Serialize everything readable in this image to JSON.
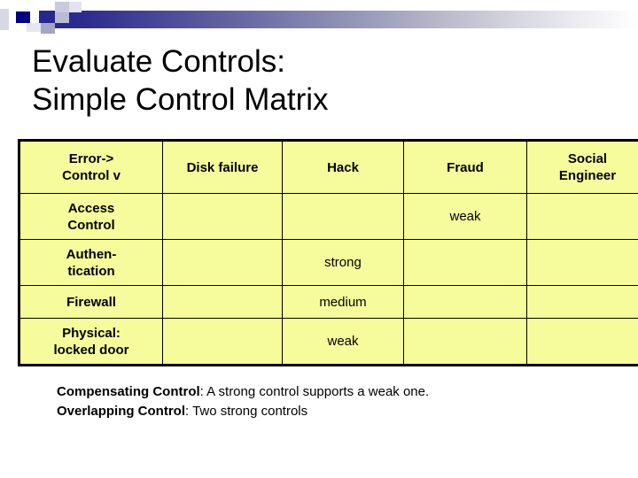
{
  "banner": {
    "gradient_start": "#26268c",
    "gradient_end": "#ffffff",
    "accent_square": "#000080"
  },
  "title": {
    "line1": "Evaluate Controls:",
    "line2": "Simple Control Matrix"
  },
  "matrix": {
    "cell_background": "#f6fb9c",
    "border_color": "#000000",
    "corner_header": {
      "line1": "Error->",
      "line2": "Control v"
    },
    "columns": [
      {
        "label": "Disk failure"
      },
      {
        "label": "Hack"
      },
      {
        "label": "Fraud"
      },
      {
        "label_line1": "Social",
        "label_line2": "Engineer"
      }
    ],
    "rows": [
      {
        "header_line1": "Access",
        "header_line2": "Control",
        "cells": [
          "",
          "",
          "weak",
          ""
        ]
      },
      {
        "header_line1": "Authen-",
        "header_line2": "tication",
        "cells": [
          "",
          "strong",
          "",
          ""
        ]
      },
      {
        "header_line1": "Firewall",
        "header_line2": "",
        "cells": [
          "",
          "medium",
          "",
          ""
        ]
      },
      {
        "header_line1": "Physical:",
        "header_line2": "locked door",
        "cells": [
          "",
          "weak",
          "",
          ""
        ]
      }
    ]
  },
  "notes": [
    {
      "lead": "Compensating Control",
      "text": ": A strong control supports a weak one."
    },
    {
      "lead": "Overlapping Control",
      "text": ": Two strong controls"
    }
  ]
}
